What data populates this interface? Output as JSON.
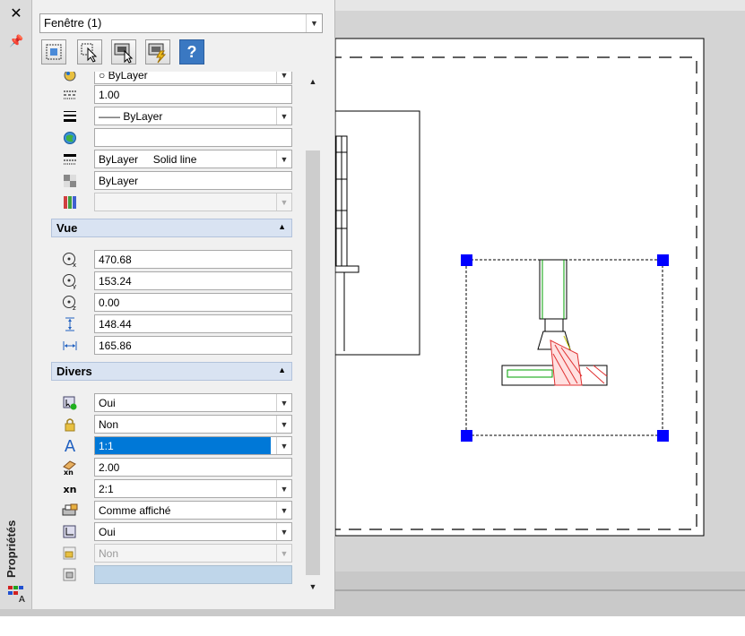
{
  "palette": {
    "title": "Propriétés",
    "selector": {
      "value": "Fenêtre (1)"
    },
    "toolbar": [
      {
        "icon": "quick-select-icon"
      },
      {
        "icon": "select-objects-icon"
      },
      {
        "icon": "toggle-pickadd-icon"
      },
      {
        "icon": "lisp-icon"
      },
      {
        "icon": "help-icon",
        "label": "?"
      }
    ]
  },
  "general": {
    "rows": [
      {
        "icon": "color-icon",
        "value": "ByLayer"
      },
      {
        "icon": "linetype-scale-icon",
        "value": "1.00"
      },
      {
        "icon": "lineweight-icon",
        "value": "—— ByLayer"
      },
      {
        "icon": "hyperlink-icon",
        "value": ""
      },
      {
        "icon": "plotstyle-icon",
        "value": "ByLayer     Solid line"
      },
      {
        "icon": "transparency-icon",
        "value": "ByLayer"
      },
      {
        "icon": "material-icon",
        "value": ""
      }
    ]
  },
  "vue": {
    "title": "Vue",
    "rows": [
      {
        "icon": "center-x-icon",
        "value": "470.68"
      },
      {
        "icon": "center-y-icon",
        "value": "153.24"
      },
      {
        "icon": "center-z-icon",
        "value": "0.00"
      },
      {
        "icon": "height-icon",
        "value": "148.44"
      },
      {
        "icon": "width-icon",
        "value": "165.86"
      }
    ]
  },
  "divers": {
    "title": "Divers",
    "rows": [
      {
        "icon": "on-icon",
        "value": "Oui"
      },
      {
        "icon": "lock-icon",
        "value": "Non"
      },
      {
        "icon": "annotation-scale-icon",
        "value": "1:1"
      },
      {
        "icon": "custom-scale-icon",
        "value": "2.00"
      },
      {
        "icon": "standard-scale-icon",
        "value": "2:1"
      },
      {
        "icon": "shade-plot-icon",
        "value": "Comme affiché"
      },
      {
        "icon": "ucs-per-viewport-icon",
        "value": "Oui"
      },
      {
        "icon": "clipped-icon",
        "value": "Non"
      },
      {
        "icon": "visual-style-icon",
        "value": ""
      }
    ]
  },
  "colors": {
    "grip": "#0000ff",
    "section_bg": "#d9e3f2",
    "selection": "#0078d7",
    "hatch": "#e03030",
    "green": "#00a000"
  }
}
